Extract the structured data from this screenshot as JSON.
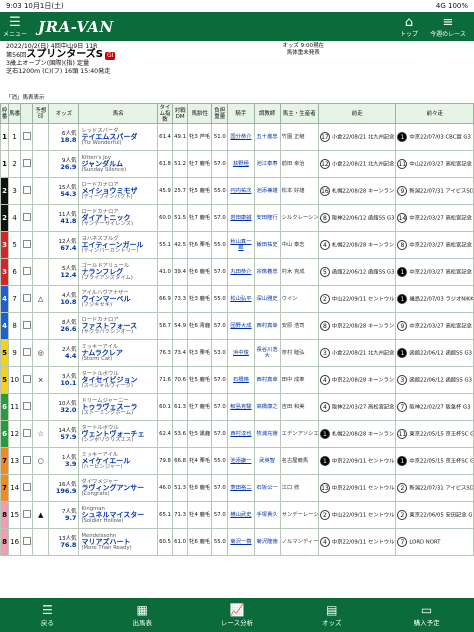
{
  "status": {
    "time": "9:03",
    "date": "10月1日(土)",
    "signal": "4G",
    "battery": "100%"
  },
  "header": {
    "menu": "メニュー",
    "logo": "JRA-VAN",
    "top": "トップ",
    "today": "今週のレース"
  },
  "race": {
    "line1": "2022/10/2(日) 4回中山9日 11R",
    "prefix": "第56回",
    "name": "スプリンターズS",
    "grade": "GI",
    "line3": "3歳上オープン(国際)(指) 定量",
    "line4": "芝右1200m (C)(フ) 16頭 15:40発走",
    "odds_time": "オッズ 9:00現在",
    "odds_note": "馬体重未発表"
  },
  "notice": "「消」馬表表示",
  "columns": [
    "枠番",
    "馬番",
    "",
    "予想印",
    "オッズ",
    "馬名",
    "タイム指数",
    "対戦DM",
    "馬齢性",
    "負担重量",
    "騎手",
    "調教師",
    "馬主・生産者",
    "前走",
    "前々走"
  ],
  "horses": [
    {
      "w": 1,
      "wc": "#ffffff",
      "wt": "#000",
      "n": 1,
      "mark": "",
      "pop": "6人気",
      "odds": "18.8",
      "name": "テイエムスパーダ",
      "sire": "レッドスパーダ",
      "dam": "(Tiz Wonderful)",
      "ti": "61.4",
      "dm": "49.1",
      "age": "牝3 芦毛",
      "wgt": "51.0",
      "jk": "国分恭介",
      "trn": "五十嵐忠",
      "own": "竹園 正継",
      "prev": "小倉22/08/21 北九州記念 G3",
      "prevr": "17",
      "prev2": "中京22/07/03 CBC賞 G3",
      "prev2r": "1"
    },
    {
      "w": 1,
      "wc": "#ffffff",
      "wt": "#000",
      "n": 2,
      "mark": "",
      "pop": "9人気",
      "odds": "26.9",
      "name": "ジャンダルム",
      "sire": "Kitten's Joy",
      "dam": "(Sunday Silence)",
      "ti": "61.8",
      "dm": "51.2",
      "age": "牡7 鹿毛",
      "wgt": "57.0",
      "jk": "荻野極",
      "trn": "池江泰寿",
      "own": "前田 幸治",
      "prev": "小倉22/08/21 北九州記念 G3",
      "prevr": "12",
      "prev2": "中山22/03/27 高松宮記念 G1",
      "prev2r": "11"
    },
    {
      "w": 2,
      "wc": "#111111",
      "wt": "#fff",
      "n": 3,
      "mark": "",
      "pop": "15人気",
      "odds": "54.3",
      "name": "メイショウミモザ",
      "sire": "ロードカナロア",
      "dam": "(ディープインパクト)",
      "ti": "45.9",
      "dm": "25.7",
      "age": "牝5 鹿毛",
      "wgt": "55.0",
      "jk": "円内祐次",
      "trn": "池添兼雄",
      "own": "松本 好雄",
      "prev": "札幌22/08/28 キーンランドC G3",
      "prevr": "16",
      "prev2": "新潟22/07/31 アイビスSD G3",
      "prev2r": "9"
    },
    {
      "w": 2,
      "wc": "#111111",
      "wt": "#fff",
      "n": 4,
      "mark": "",
      "pop": "11人気",
      "odds": "41.8",
      "name": "ダイアトニック",
      "sire": "ロードカナロア",
      "dam": "(サンデーサイレンス)",
      "ti": "60.0",
      "dm": "51.5",
      "age": "牡7 鹿毛",
      "wgt": "57.0",
      "jk": "岩田康誠",
      "trn": "安田隆行",
      "own": "シルクレーシング",
      "prev": "阪神22/06/12 函館SS G3",
      "prevr": "8",
      "prev2": "中京22/03/27 高松宮記念 G1",
      "prev2r": "14"
    },
    {
      "w": 3,
      "wc": "#d8232a",
      "wt": "#fff",
      "n": 5,
      "mark": "",
      "pop": "12人気",
      "odds": "67.4",
      "name": "エイティーンガール",
      "sire": "ヨハネスブルグ",
      "dam": "(ティンバーカントリー)",
      "ti": "55.1",
      "dm": "42.5",
      "age": "牝6 栗毛",
      "wgt": "55.0",
      "jk": "秋山真一郎",
      "trn": "飯田祐史",
      "own": "中山 泰志",
      "prev": "札幌22/08/28 キーンランドC G3",
      "prevr": "4",
      "prev2": "中京22/03/27 高松宮記念 G1",
      "prev2r": "8"
    },
    {
      "w": 3,
      "wc": "#d8232a",
      "wt": "#fff",
      "n": 6,
      "mark": "",
      "pop": "5人気",
      "odds": "12.4",
      "name": "ナランフレグ",
      "sire": "ゴールドアリュール",
      "dam": "(ブライアンズタイム)",
      "ti": "41.0",
      "dm": "39.4",
      "age": "牡6 鹿毛",
      "wgt": "57.0",
      "jk": "丸田恭介",
      "trn": "宗像義忠",
      "own": "村木 克成",
      "prev": "函館22/06/12 函館SS G3",
      "prevr": "5",
      "prev2": "中京22/03/27 高松宮記念 G1",
      "prev2r": "1"
    },
    {
      "w": 4,
      "wc": "#1f5fd6",
      "wt": "#fff",
      "n": 7,
      "mark": "△",
      "pop": "4人気",
      "odds": "10.8",
      "name": "ウインマーベル",
      "sire": "アイルハヴアナザー",
      "dam": "(フジキセキ)",
      "ti": "66.9",
      "dm": "73.3",
      "age": "牡3 鹿毛",
      "wgt": "55.0",
      "jk": "松山弘平",
      "trn": "深山雅史",
      "own": "ウイン",
      "prev": "中山22/09/11 セントウルS G2",
      "prevr": "2",
      "prev2": "福島22/07/03 ラジオNIKKEI賞 G3",
      "prev2r": "1"
    },
    {
      "w": 4,
      "wc": "#1f5fd6",
      "wt": "#fff",
      "n": 8,
      "mark": "",
      "pop": "8人気",
      "odds": "26.6",
      "name": "ファストフォース",
      "sire": "ロードカナロア",
      "dam": "(サクラバクシンオー)",
      "ti": "58.7",
      "dm": "54.9",
      "age": "牡6 青鹿",
      "wgt": "57.0",
      "jk": "団野大成",
      "trn": "西村真幸",
      "own": "安原 浩司",
      "prev": "中京22/08/28 キーンランドC G3",
      "prevr": "8",
      "prev2": "中京22/03/27 高松宮記念 G1",
      "prev2r": "9"
    },
    {
      "w": 5,
      "wc": "#f2d21b",
      "wt": "#000",
      "n": 9,
      "mark": "◎",
      "pop": "2人気",
      "odds": "4.4",
      "name": "ナムラクレア",
      "sire": "ミッキーアイル",
      "dam": "(Storm Cat)",
      "ti": "76.3",
      "dm": "73.4",
      "age": "牝3 栗毛",
      "wgt": "53.0",
      "jk": "浜中俊",
      "trn": "長谷川浩大",
      "own": "奈村 睦弘",
      "prev": "小倉22/08/21 北九州記念 G3",
      "prevr": "3",
      "prev2": "函館22/06/12 函館SS G3",
      "prev2r": "1"
    },
    {
      "w": 5,
      "wc": "#f2d21b",
      "wt": "#000",
      "n": 10,
      "mark": "×",
      "pop": "3人気",
      "odds": "10.1",
      "name": "タイセイビジョン",
      "sire": "タートルボウル",
      "dam": "(スペシャルウィーク)",
      "ti": "71.6",
      "dm": "70.6",
      "age": "牡5 鹿毛",
      "wgt": "57.0",
      "jk": "石橋脩",
      "trn": "西村真幸",
      "own": "田中 成奉",
      "prev": "中京22/08/28 キーンランドC G3",
      "prevr": "4",
      "prev2": "函館22/06/12 函館SS G3",
      "prev2r": "3"
    },
    {
      "w": 6,
      "wc": "#2a9a3e",
      "wt": "#fff",
      "n": 11,
      "mark": "",
      "pop": "10人気",
      "odds": "32.0",
      "name": "トゥラヴェスーラ",
      "sire": "ドリームジャーニー",
      "dam": "(ストーミングホーム)",
      "ti": "60.1",
      "dm": "61.3",
      "age": "牡7 鹿毛",
      "wgt": "57.0",
      "jk": "鮫島克駿",
      "trn": "高橋康之",
      "own": "吉田 和美",
      "prev": "阪神22/03/27 高松宮記念 G1",
      "prevr": "4",
      "prev2": "阪神22/02/27 阪急杯 G3",
      "prev2r": "7"
    },
    {
      "w": 6,
      "wc": "#2a9a3e",
      "wt": "#fff",
      "n": 12,
      "mark": "☆",
      "pop": "14人気",
      "odds": "57.9",
      "name": "ヴェントヴォーチェ",
      "sire": "タートルボウル",
      "dam": "(シンボリクリスエス)",
      "ti": "62.4",
      "dm": "53.6",
      "age": "牡5 黒鹿",
      "wgt": "57.0",
      "jk": "西村淳也",
      "trn": "牧浦充徳",
      "own": "エデンアソシエ",
      "prev": "札幌22/08/28 キーンランドC G3",
      "prevr": "1",
      "prev2": "東京22/05/15 京王杯SC G2",
      "prev2r": "11"
    },
    {
      "w": 7,
      "wc": "#f28a1e",
      "wt": "#000",
      "n": 13,
      "mark": "○",
      "pop": "1人気",
      "odds": "3.9",
      "name": "メイケイエール",
      "sire": "ミッキーアイル",
      "dam": "(ハービンジャー)",
      "ti": "79.8",
      "dm": "66.8",
      "age": "牝4 栗毛",
      "wgt": "55.0",
      "jk": "池添謙一",
      "trn": "武英智",
      "own": "名古屋競馬",
      "prev": "中京22/09/11 セントウルS G2",
      "prevr": "1",
      "prev2": "中京22/05/15 京王杯SC G2",
      "prev2r": "1"
    },
    {
      "w": 7,
      "wc": "#f28a1e",
      "wt": "#000",
      "n": 14,
      "mark": "",
      "pop": "16人気",
      "odds": "196.9",
      "name": "ラヴィングアンサー",
      "sire": "ダイワメジャー",
      "dam": "(Congrats)",
      "ti": "46.0",
      "dm": "51.3",
      "age": "牡8 鹿毛",
      "wgt": "57.0",
      "jk": "菱田裕二",
      "trn": "石坂公一",
      "own": "江口 修",
      "prev": "中京22/09/11 セントウルS G2",
      "prevr": "13",
      "prev2": "新潟22/07/31 アイビスSD G3",
      "prev2r": "2"
    },
    {
      "w": 8,
      "wc": "#f29bb3",
      "wt": "#000",
      "n": 15,
      "mark": "▲",
      "pop": "7人気",
      "odds": "9.7",
      "name": "シュネルマイスター",
      "sire": "Kingman",
      "dam": "(Soldier Hollow)",
      "ti": "65.1",
      "dm": "71.3",
      "age": "牡4 鹿毛",
      "wgt": "57.0",
      "jk": "横山武史",
      "trn": "手塚貴久",
      "own": "サンデーレーシング",
      "prev": "中山22/09/11 セントウルS G2",
      "prevr": "2",
      "prev2": "東京22/06/05 安田記念 G1",
      "prev2r": "2"
    },
    {
      "w": 8,
      "wc": "#f29bb3",
      "wt": "#000",
      "n": 16,
      "mark": "",
      "pop": "13人気",
      "odds": "76.8",
      "name": "マリアズハート",
      "sire": "Mendelssohn",
      "dam": "(More Than Ready)",
      "ti": "60.5",
      "dm": "61.0",
      "age": "牝6 鹿毛",
      "wgt": "55.0",
      "jk": "菊沢一樹",
      "trn": "菊沢隆徳",
      "own": "ノルマンディー",
      "prev": "中京22/09/11 セントウルS G2",
      "prevr": "4",
      "prev2": "LORD NORT",
      "prev2r": "7"
    }
  ],
  "footer": {
    "back": "戻る",
    "entries": "出馬表",
    "analysis": "レース分析",
    "odds": "オッズ",
    "buy": "購入予定"
  }
}
